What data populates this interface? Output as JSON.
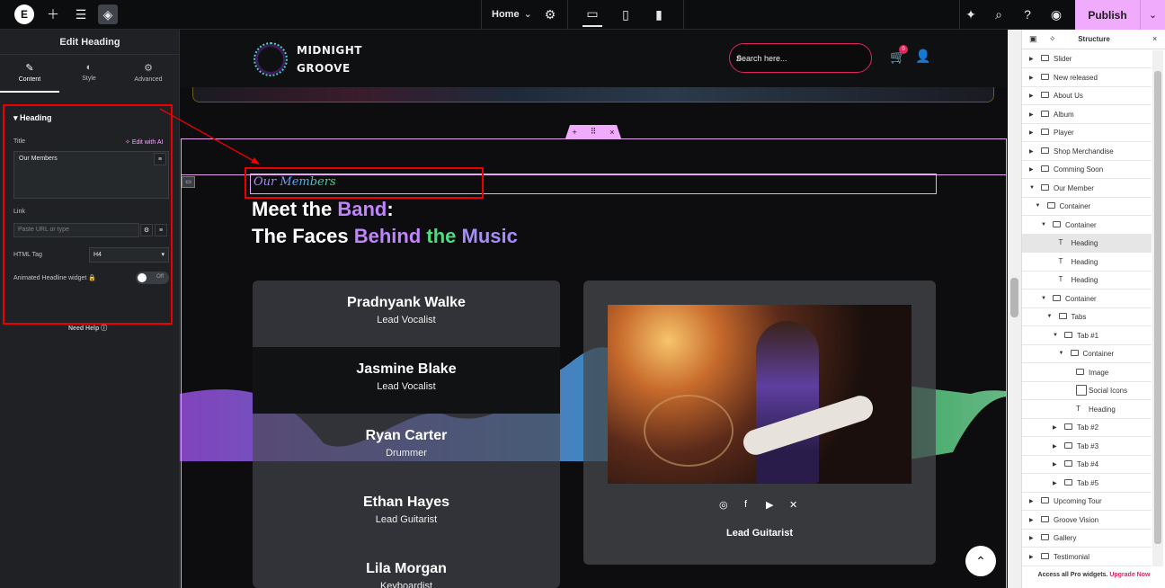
{
  "topbar": {
    "logo": "E",
    "page_name": "Home",
    "publish_label": "Publish",
    "icons": [
      "plus-icon",
      "sliders-icon",
      "layers-icon",
      "gear-icon",
      "desktop-icon",
      "tablet-icon",
      "mobile-icon",
      "ai-sparkle-icon",
      "search-icon",
      "help-icon",
      "eye-icon",
      "chevron-down-icon"
    ]
  },
  "left_panel": {
    "title": "Edit Heading",
    "tabs": [
      {
        "label": "Content",
        "icon": "pencil-icon"
      },
      {
        "label": "Style",
        "icon": "contrast-icon"
      },
      {
        "label": "Advanced",
        "icon": "gear-icon"
      }
    ],
    "section_title": "Heading",
    "title_label": "Title",
    "edit_ai_label": "Edit with AI",
    "title_value": "Our Members",
    "link_label": "Link",
    "link_placeholder": "Paste URL or type",
    "html_tag_label": "HTML Tag",
    "html_tag_value": "H4",
    "animated_label": "Animated Headline widget",
    "toggle_state": "Off",
    "need_help": "Need Help"
  },
  "site": {
    "brand_line1": "MIDNIGHT",
    "brand_line2": "GROOVE",
    "search_placeholder": "Search here...",
    "cart_count": "0",
    "section_tag": "Our Members",
    "heading_line1": {
      "w1": "Meet the ",
      "w2": "Band",
      "w3": ":"
    },
    "heading_line2": {
      "w1": "The Faces ",
      "w2": "Behind",
      "w3": " the ",
      "w4": "Music"
    },
    "members": [
      {
        "name": "Pradnyank Walke",
        "role": "Lead Vocalist"
      },
      {
        "name": "Jasmine Blake",
        "role": "Lead Vocalist"
      },
      {
        "name": "Ryan Carter",
        "role": "Drummer"
      },
      {
        "name": "Ethan Hayes",
        "role": "Lead Guitarist"
      },
      {
        "name": "Lila Morgan",
        "role": "Keyboardist"
      }
    ],
    "photo_caption": "Lead Guitarist",
    "social_icons": [
      "instagram-icon",
      "facebook-icon",
      "youtube-icon",
      "x-icon"
    ]
  },
  "structure": {
    "title": "Structure",
    "items": [
      {
        "label": "Slider"
      },
      {
        "label": "New released"
      },
      {
        "label": "About Us"
      },
      {
        "label": "Album"
      },
      {
        "label": "Player"
      },
      {
        "label": "Shop Merchandise"
      },
      {
        "label": "Comming Soon"
      },
      {
        "label": "Our Member"
      },
      {
        "label": "Container"
      },
      {
        "label": "Container"
      },
      {
        "label": "Heading"
      },
      {
        "label": "Heading"
      },
      {
        "label": "Heading"
      },
      {
        "label": "Container"
      },
      {
        "label": "Tabs"
      },
      {
        "label": "Tab #1"
      },
      {
        "label": "Container"
      },
      {
        "label": "Image"
      },
      {
        "label": "Social Icons"
      },
      {
        "label": "Heading"
      },
      {
        "label": "Tab #2"
      },
      {
        "label": "Tab #3"
      },
      {
        "label": "Tab #4"
      },
      {
        "label": "Tab #5"
      },
      {
        "label": "Upcoming Tour"
      },
      {
        "label": "Groove Vision"
      },
      {
        "label": "Gallery"
      },
      {
        "label": "Testimonial"
      }
    ],
    "footer_text": "Access all Pro widgets.",
    "footer_link": "Upgrade Now"
  },
  "colors": {
    "accent": "#f0abfc",
    "brand_red": "#e0245e",
    "annotation": "#ee0000"
  }
}
